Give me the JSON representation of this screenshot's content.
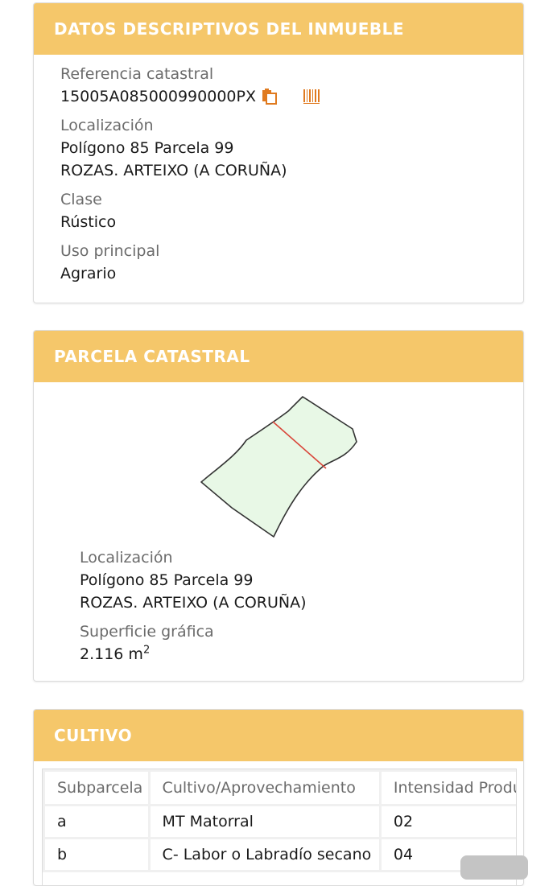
{
  "descriptive": {
    "title": "DATOS DESCRIPTIVOS DEL INMUEBLE",
    "ref_label": "Referencia catastral",
    "ref_value": "15005A085000990000PX",
    "loc_label": "Localización",
    "loc_line1": "Polígono 85 Parcela 99",
    "loc_line2": "ROZAS. ARTEIXO (A CORUÑA)",
    "clase_label": "Clase",
    "clase_value": "Rústico",
    "uso_label": "Uso principal",
    "uso_value": "Agrario",
    "icons": [
      "copy-icon",
      "barcode-icon"
    ]
  },
  "parcel": {
    "title": "PARCELA CATASTRAL",
    "loc_label": "Localización",
    "loc_line1": "Polígono 85 Parcela 99",
    "loc_line2": "ROZAS. ARTEIXO (A CORUÑA)",
    "surface_label": "Superficie gráfica",
    "surface_value": "2.116 m",
    "surface_unit_sup": "2",
    "colors": {
      "fill": "#e8f8e6",
      "outline": "#333333",
      "divider": "#d9463a"
    }
  },
  "cultivo": {
    "title": "CULTIVO",
    "headers": [
      "Subparcela",
      "Cultivo/Aprovechamiento",
      "Intensidad Productiva"
    ],
    "rows": [
      [
        "a",
        "MT Matorral",
        "02"
      ],
      [
        "b",
        "C- Labor o Labradío secano",
        "04"
      ]
    ]
  },
  "colors": {
    "header_bg": "#f5c76a",
    "accent_icon": "#e07a1f"
  }
}
